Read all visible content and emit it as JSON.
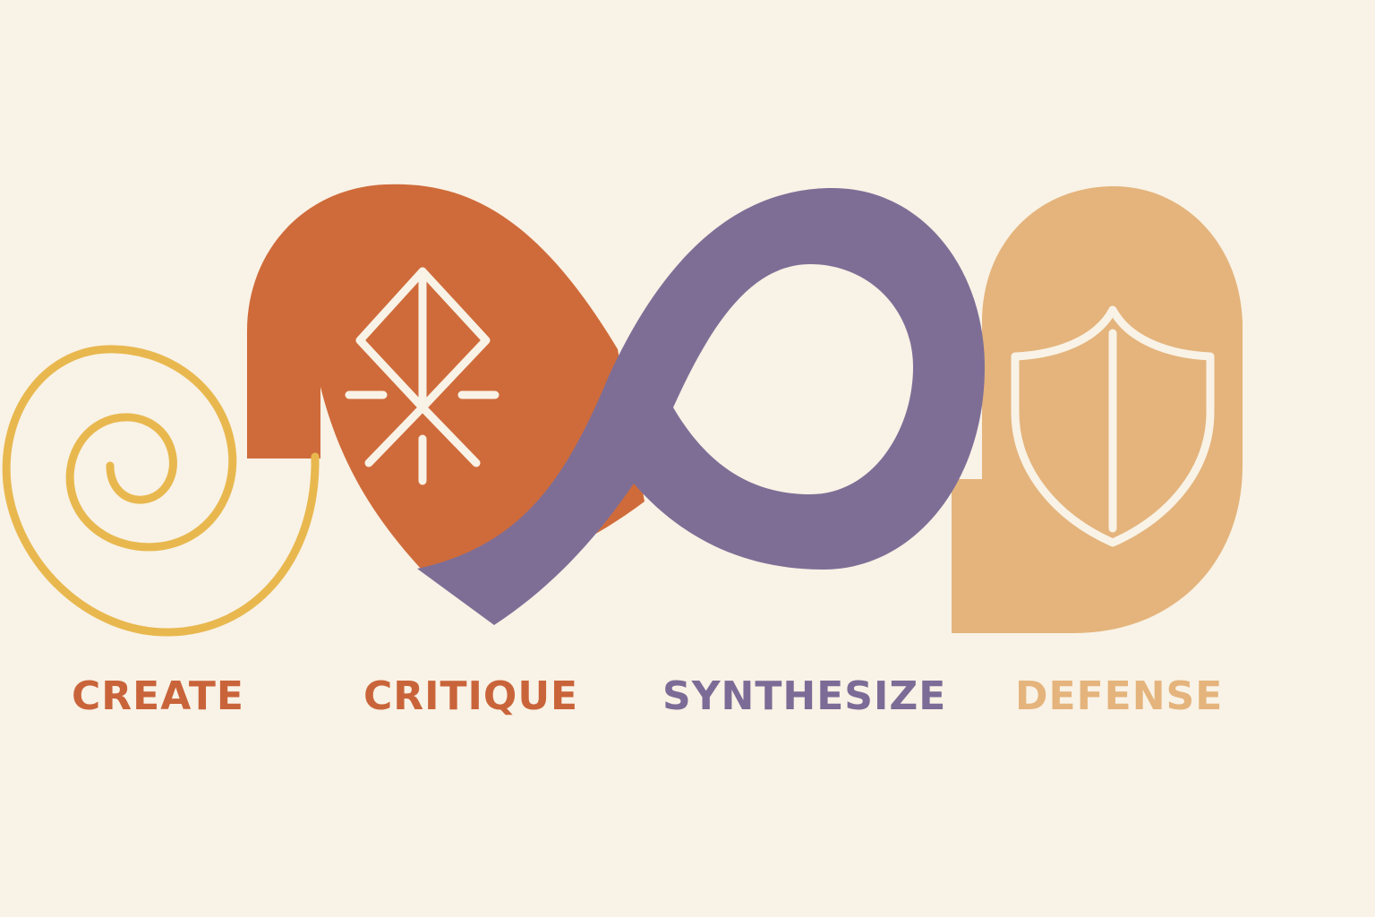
{
  "stages": [
    {
      "label": "CREATE",
      "icon": "spiral-icon",
      "color": "#c9643a",
      "shape_color": "#e8b84f"
    },
    {
      "label": "CRITIQUE",
      "icon": "compass-star-icon",
      "color": "#c9643a",
      "shape_color": "#cf6b3a"
    },
    {
      "label": "SYNTHESIZE",
      "icon": "loop-icon",
      "color": "#7c6b96",
      "shape_color": "#7e6e96"
    },
    {
      "label": "DEFENSE",
      "icon": "shield-icon",
      "color": "#e4b47c",
      "shape_color": "#e4b47c"
    }
  ],
  "colors": {
    "background": "#f9f2e6",
    "icon_stroke": "#f9f2e6"
  }
}
